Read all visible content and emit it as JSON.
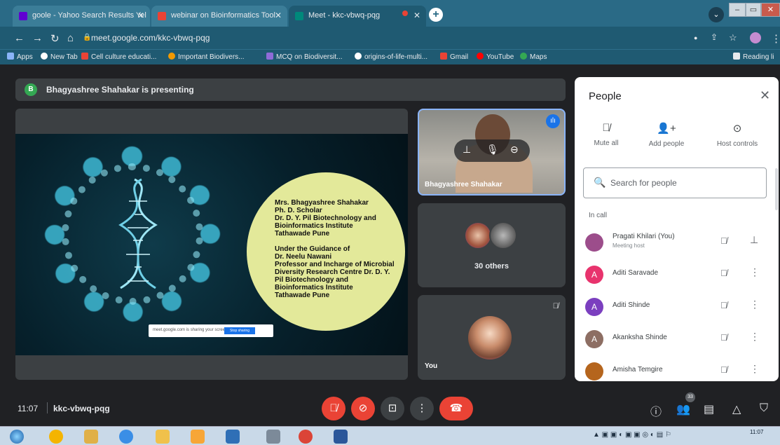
{
  "browser": {
    "tabs": [
      {
        "title": "goole - Yahoo Search Results Yel",
        "active": false,
        "favicon_color": "#6001d2"
      },
      {
        "title": "webinar on Bioinformatics Tool",
        "active": false,
        "favicon_color": "#ea4335"
      },
      {
        "title": "Meet - kkc-vbwq-pqg",
        "active": true,
        "favicon_color": "#00897b"
      }
    ],
    "new_tab": "+",
    "url": "meet.google.com/kkc-vbwq-pqg",
    "bookmarks": [
      "Apps",
      "New Tab",
      "Cell culture educati...",
      "Important Biodivers...",
      "MCQ on Biodiversit...",
      "origins-of-life-multi...",
      "Gmail",
      "YouTube",
      "Maps"
    ],
    "reading_list": "Reading li"
  },
  "meet": {
    "presenting_banner": "Bhagyashree Shahakar is presenting",
    "presenter_initial": "B",
    "slide": {
      "text_block": "Mrs. Bhagyashree Shahakar\nPh. D. Scholar\nDr. D. Y. Pil Biotechnology and\nBioinformatics Institute\nTathawade Pune\n\nUnder the Guidance of\nDr. Neelu Nawani\nProfessor and Incharge of Microbial\nDiversity Research Centre Dr. D. Y.\nPil Biotechnology and\nBioinformatics Institute\nTathawade Pune",
      "popup_text": "meet.google.com is sharing your screen",
      "popup_button": "Stop sharing"
    },
    "tiles": {
      "presenter_name": "Bhagyashree Shahakar",
      "others_label": "30 others",
      "you_label": "You"
    },
    "bottom": {
      "time": "11:07",
      "meeting_code": "kkc-vbwq-pqg",
      "participant_count": "33"
    }
  },
  "people_panel": {
    "title": "People",
    "actions": [
      {
        "label": "Mute all",
        "icon": "mic-off-icon"
      },
      {
        "label": "Add people",
        "icon": "add-person-icon"
      },
      {
        "label": "Host controls",
        "icon": "toggle-icon"
      }
    ],
    "search_placeholder": "Search for people",
    "section_label": "In call",
    "participants": [
      {
        "name": "Pragati Khilari (You)",
        "sub": "Meeting host",
        "initial": "",
        "color": "#9c4d8b",
        "photo": true,
        "right_icon": "pin-icon"
      },
      {
        "name": "Aditi Saravade",
        "sub": "",
        "initial": "A",
        "color": "#e8336d",
        "photo": false,
        "right_icon": "more-icon"
      },
      {
        "name": "Aditi Shinde",
        "sub": "",
        "initial": "A",
        "color": "#7b3fbf",
        "photo": false,
        "right_icon": "more-icon"
      },
      {
        "name": "Akanksha Shinde",
        "sub": "",
        "initial": "A",
        "color": "#8d6e63",
        "photo": false,
        "right_icon": "more-icon"
      },
      {
        "name": "Amisha Temgire",
        "sub": "",
        "initial": "",
        "color": "#b5651d",
        "photo": true,
        "right_icon": "more-icon"
      }
    ]
  },
  "taskbar": {
    "clock_time": "11:07"
  }
}
